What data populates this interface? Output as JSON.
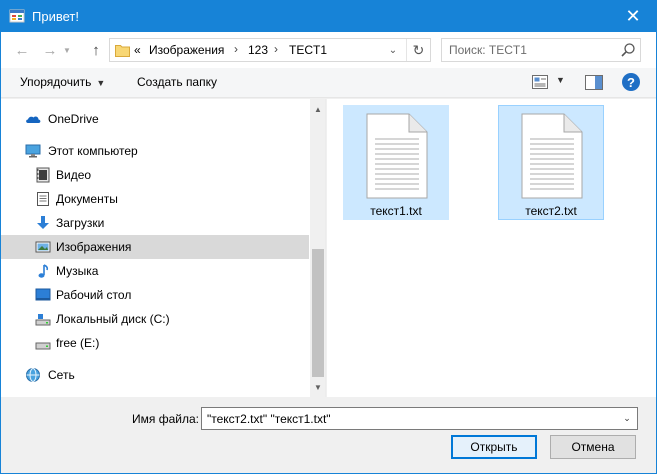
{
  "window": {
    "title": "Привет!",
    "close_glyph": "✕"
  },
  "navigation": {
    "back_glyph": "←",
    "forward_glyph": "→",
    "up_glyph": "↑",
    "overflow": "«",
    "breadcrumbs": [
      "Изображения",
      "123",
      "TECT1"
    ],
    "separator": "›",
    "dropdown_glyph": "⌄",
    "refresh_glyph": "↻",
    "search_placeholder": "Поиск: TECT1"
  },
  "toolbar": {
    "organize_label": "Упорядочить",
    "organize_caret": "▼",
    "new_folder_label": "Создать папку",
    "view_caret": "▼",
    "help_glyph": "?"
  },
  "sidebar": {
    "items": [
      {
        "label": "OneDrive",
        "icon": "onedrive-icon"
      },
      {
        "label": "Этот компьютер",
        "icon": "computer-icon"
      },
      {
        "label": "Видео",
        "icon": "video-icon"
      },
      {
        "label": "Документы",
        "icon": "documents-icon"
      },
      {
        "label": "Загрузки",
        "icon": "downloads-icon"
      },
      {
        "label": "Изображения",
        "icon": "pictures-icon",
        "selected": true
      },
      {
        "label": "Музыка",
        "icon": "music-icon"
      },
      {
        "label": "Рабочий стол",
        "icon": "desktop-icon"
      },
      {
        "label": "Локальный диск (C:)",
        "icon": "local-disk-icon"
      },
      {
        "label": "free (E:)",
        "icon": "drive-icon"
      },
      {
        "label": "Сеть",
        "icon": "network-icon"
      }
    ],
    "scroll_up_glyph": "▲",
    "scroll_down_glyph": "▼"
  },
  "files": [
    {
      "name": "текст1.txt",
      "selected": true
    },
    {
      "name": "текст2.txt",
      "selected": true
    }
  ],
  "bottom": {
    "filename_label": "Имя файла:",
    "filename_value": "\"текст2.txt\" \"текст1.txt\"",
    "filename_dropdown_glyph": "⌄",
    "open_label": "Открыть",
    "cancel_label": "Отмена"
  },
  "colors": {
    "titlebar": "#1783d7",
    "selection": "#cce8ff",
    "selection_border": "#99d1ff",
    "nav_selected": "#d9d9d9",
    "help": "#1f6fc5"
  }
}
